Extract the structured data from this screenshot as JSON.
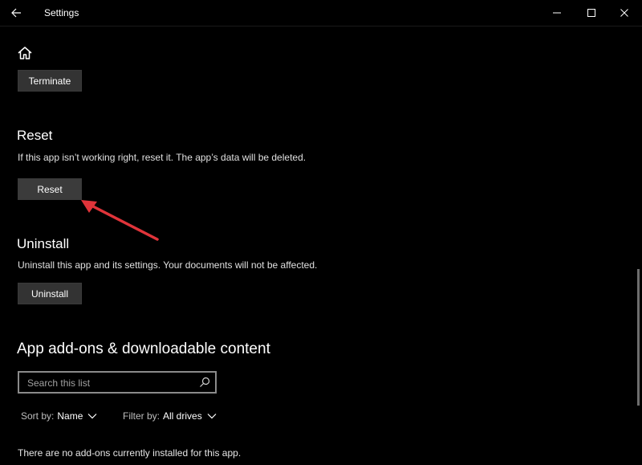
{
  "window": {
    "title": "Settings"
  },
  "titlebar": {
    "back_icon": "back-arrow-icon",
    "controls": [
      "minimize-icon",
      "maximize-icon",
      "close-icon"
    ]
  },
  "home_icon": "home-icon",
  "terminate": {
    "button_label": "Terminate"
  },
  "reset": {
    "heading": "Reset",
    "description": "If this app isn’t working right, reset it. The app’s data will be deleted.",
    "button_label": "Reset"
  },
  "uninstall": {
    "heading": "Uninstall",
    "description": "Uninstall this app and its settings. Your documents will not be affected.",
    "button_label": "Uninstall"
  },
  "addons": {
    "heading": "App add-ons & downloadable content",
    "search_placeholder": "Search this list",
    "sort_label": "Sort by:",
    "sort_value": "Name",
    "filter_label": "Filter by:",
    "filter_value": "All drives",
    "empty_message": "There are no add-ons currently installed for this app."
  },
  "annotation": {
    "arrow_color": "#e0343a"
  }
}
